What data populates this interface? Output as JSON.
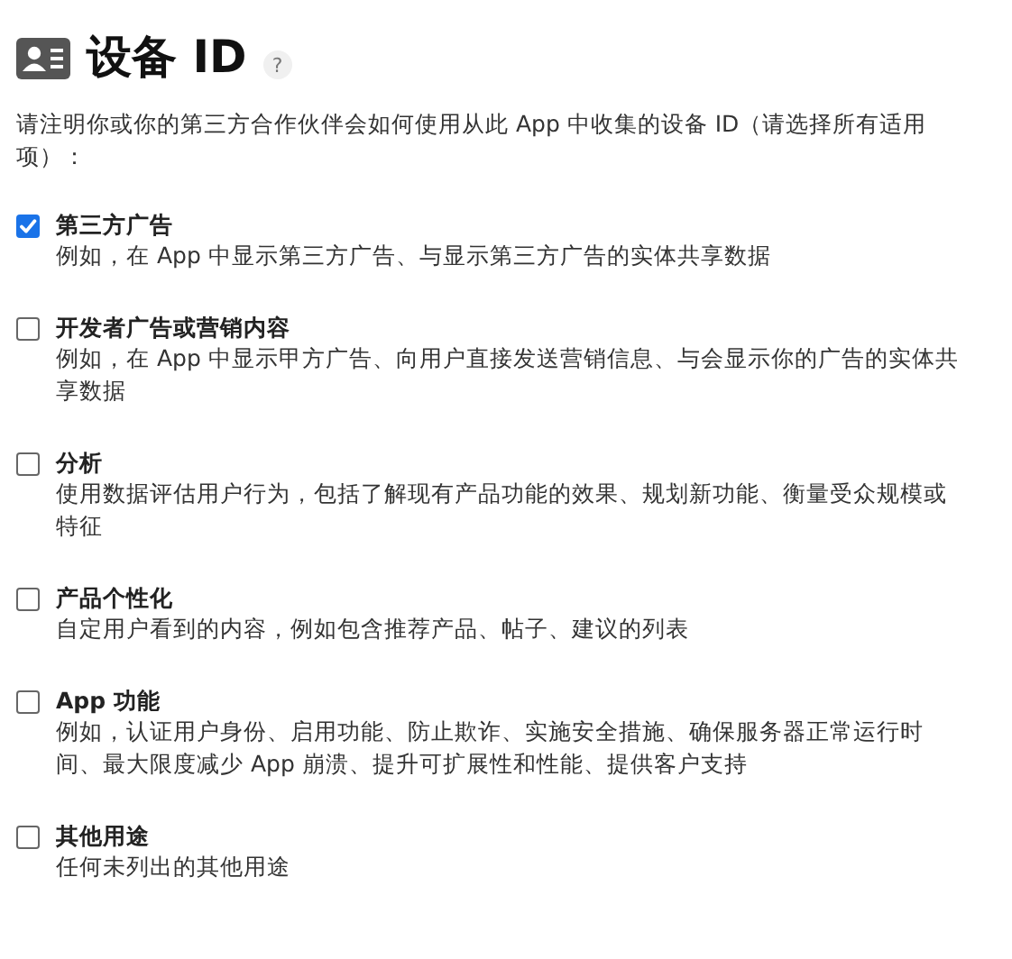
{
  "header": {
    "title": "设备 ID",
    "help": "?"
  },
  "intro": "请注明你或你的第三方合作伙伴会如何使用从此 App 中收集的设备 ID（请选择所有适用项）：",
  "options": [
    {
      "label": "第三方广告",
      "description": "例如，在 App 中显示第三方广告、与显示第三方广告的实体共享数据",
      "checked": true
    },
    {
      "label": "开发者广告或营销内容",
      "description": "例如，在 App 中显示甲方广告、向用户直接发送营销信息、与会显示你的广告的实体共享数据",
      "checked": false
    },
    {
      "label": "分析",
      "description": "使用数据评估用户行为，包括了解现有产品功能的效果、规划新功能、衡量受众规模或特征",
      "checked": false
    },
    {
      "label": "产品个性化",
      "description": "自定用户看到的内容，例如包含推荐产品、帖子、建议的列表",
      "checked": false
    },
    {
      "label": "App 功能",
      "description": "例如，认证用户身份、启用功能、防止欺诈、实施安全措施、确保服务器正常运行时间、最大限度减少 App 崩溃、提升可扩展性和性能、提供客户支持",
      "checked": false
    },
    {
      "label": "其他用途",
      "description": "任何未列出的其他用途",
      "checked": false
    }
  ]
}
